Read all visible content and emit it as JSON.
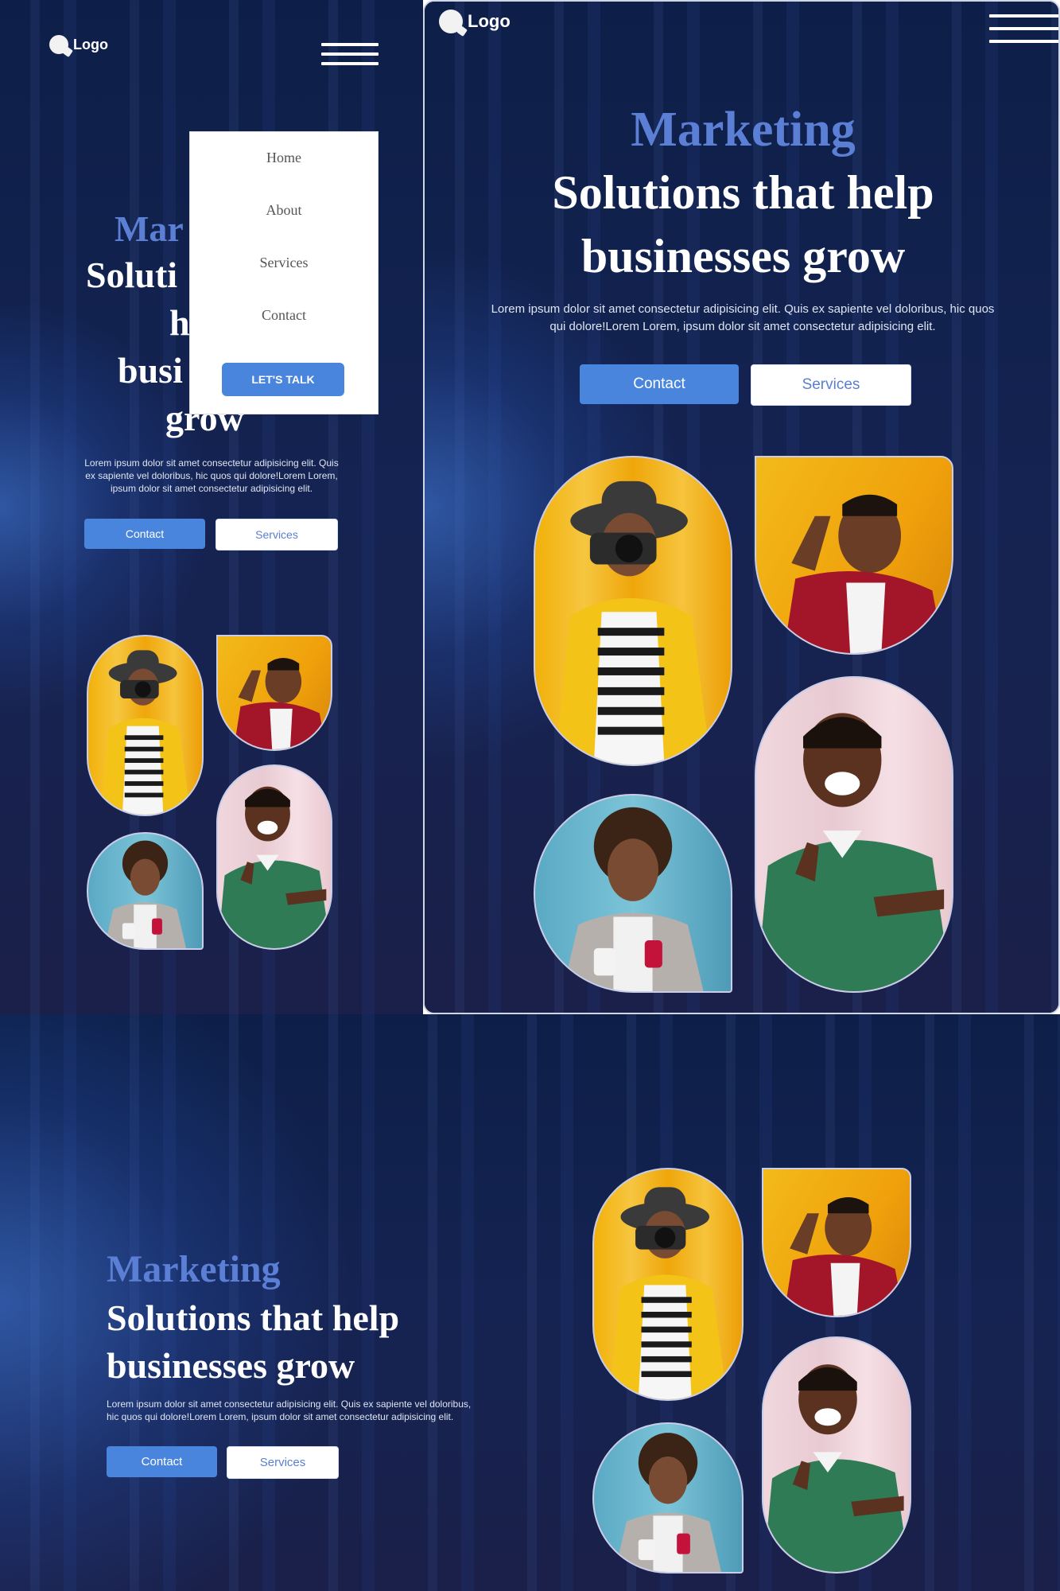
{
  "logo": {
    "text": "Logo"
  },
  "menu": {
    "items": [
      "Home",
      "About",
      "Services",
      "Contact"
    ],
    "cta": "LET'S TALK"
  },
  "hero": {
    "kicker": "Marketing",
    "headline_line1": "Solutions that help",
    "headline_line2": "businesses grow",
    "body": "Lorem ipsum dolor sit amet consectetur adipisicing elit. Quis ex sapiente vel doloribus, hic quos qui dolore!Lorem Lorem, ipsum dolor sit amet consectetur adipisicing elit.",
    "contact_button": "Contact",
    "services_button": "Services"
  },
  "mobile_hero_partial": {
    "kicker": "Mar",
    "line1": "Soluti",
    "line2": "h",
    "line3": "busi",
    "line4": "grow"
  },
  "colors": {
    "background": "#0e1d3f",
    "accent_blue": "#4a85dd",
    "kicker_blue": "#5c7fd6",
    "white": "#ffffff"
  },
  "icons": [
    "logo-icon",
    "hamburger-menu-icon"
  ]
}
